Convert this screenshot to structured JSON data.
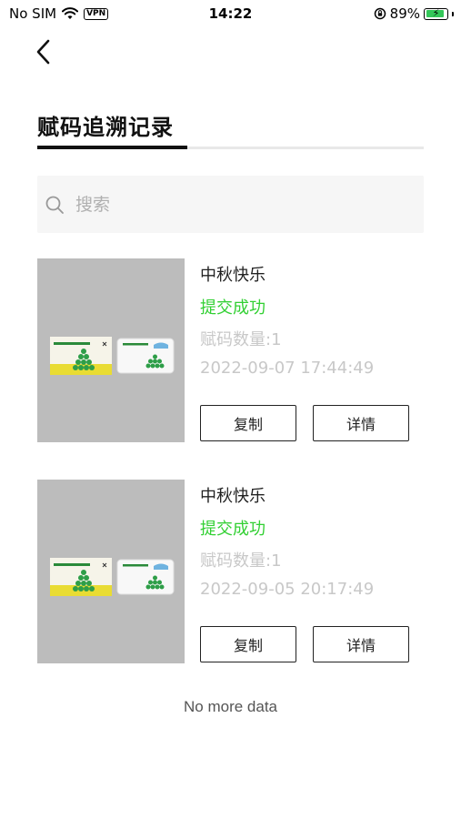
{
  "status_bar": {
    "carrier": "No SIM",
    "vpn": "VPN",
    "time": "14:22",
    "battery": "89%",
    "battery_level": 0.89,
    "battery_color": "#34c759"
  },
  "header": {
    "back_icon": "chevron-left-icon",
    "title": "赋码追溯记录"
  },
  "search": {
    "placeholder": "搜索",
    "icon": "search-icon"
  },
  "records": [
    {
      "name": "中秋快乐",
      "status": "提交成功",
      "count": "赋码数量:1",
      "time": "2022-09-07 17:44:49",
      "copy_label": "复制",
      "detail_label": "详情"
    },
    {
      "name": "中秋快乐",
      "status": "提交成功",
      "count": "赋码数量:1",
      "time": "2022-09-05 20:17:49",
      "copy_label": "复制",
      "detail_label": "详情"
    }
  ],
  "footer": {
    "no_more": "No more data"
  },
  "colors": {
    "accent_success": "#32d033",
    "muted_text": "#c8c8c8",
    "thumb_bg": "#bdbdbd"
  }
}
